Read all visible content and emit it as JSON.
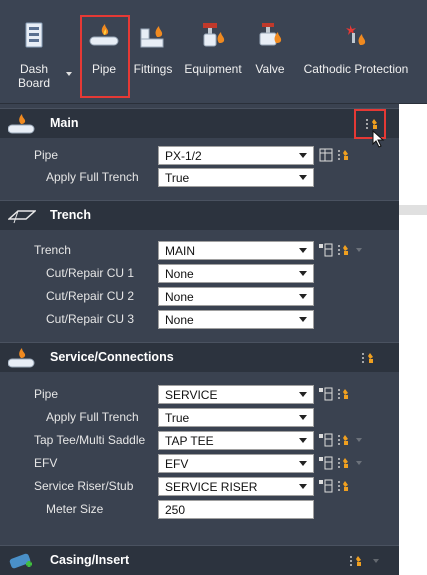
{
  "ribbon": {
    "buttons": [
      {
        "label": "Dash\nBoard",
        "icon": "dashboard-icon"
      },
      {
        "label": "Pipe",
        "icon": "pipe-icon"
      },
      {
        "label": "Fittings",
        "icon": "fittings-icon"
      },
      {
        "label": "Equipment",
        "icon": "equipment-icon"
      },
      {
        "label": "Valve",
        "icon": "valve-icon"
      },
      {
        "label": "Cathodic Protection",
        "icon": "cathodic-protection-icon"
      }
    ],
    "dash_line1": "Dash",
    "dash_line2": "Board"
  },
  "sections": {
    "main": {
      "title": "Main",
      "rows": [
        {
          "label": "Pipe",
          "value": "PX-1/2"
        },
        {
          "label": "Apply Full Trench",
          "value": "True"
        }
      ]
    },
    "trench": {
      "title": "Trench",
      "rows": [
        {
          "label": "Trench",
          "value": "MAIN"
        },
        {
          "label": "Cut/Repair CU 1",
          "value": "None"
        },
        {
          "label": "Cut/Repair CU 2",
          "value": "None"
        },
        {
          "label": "Cut/Repair CU 3",
          "value": "None"
        }
      ]
    },
    "service": {
      "title": "Service/Connections",
      "rows": [
        {
          "label": "Pipe",
          "value": "SERVICE"
        },
        {
          "label": "Apply Full Trench",
          "value": "True"
        },
        {
          "label": "Tap Tee/Multi Saddle",
          "value": "TAP TEE"
        },
        {
          "label": "EFV",
          "value": "EFV"
        },
        {
          "label": "Service Riser/Stub",
          "value": "SERVICE RISER"
        },
        {
          "label": "Meter Size",
          "value": "250"
        }
      ]
    },
    "casing": {
      "title": "Casing/Insert"
    }
  },
  "colors": {
    "ribbon_bg": "#3b4453",
    "panel_bg": "#3a4250",
    "header_bg": "#2c333e",
    "highlight": "#e53935",
    "accent_orange": "#f0a020"
  }
}
